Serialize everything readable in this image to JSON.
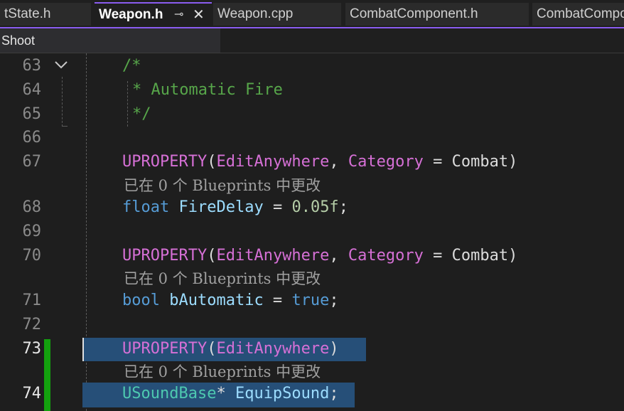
{
  "tabs": [
    {
      "label": "tState.h"
    },
    {
      "label": "Weapon.h",
      "pin": "⊸",
      "close": "✕"
    },
    {
      "label": "Weapon.cpp"
    },
    {
      "label": "CombatComponent.h"
    },
    {
      "label": "CombatCompo"
    }
  ],
  "scope": "Shoot",
  "code": {
    "l63": {
      "num": "63",
      "text": "/*"
    },
    "l64": {
      "num": "64",
      "text": "* Automatic Fire"
    },
    "l65": {
      "num": "65",
      "text": "*/"
    },
    "l66": {
      "num": "66"
    },
    "l67": {
      "num": "67",
      "macro": "UPROPERTY",
      "open": "(",
      "spec": "EditAnywhere",
      "comma": ", ",
      "cat": "Category",
      "eq": " = ",
      "val": "Combat",
      "close": ")"
    },
    "h67": "已在 0 个 Blueprints 中更改",
    "l68": {
      "num": "68",
      "type": "float",
      "name": "FireDelay",
      "eq": " = ",
      "value": "0.05f",
      "semi": ";"
    },
    "l69": {
      "num": "69"
    },
    "l70": {
      "num": "70",
      "macro": "UPROPERTY",
      "open": "(",
      "spec": "EditAnywhere",
      "comma": ", ",
      "cat": "Category",
      "eq": " = ",
      "val": "Combat",
      "close": ")"
    },
    "h70": "已在 0 个 Blueprints 中更改",
    "l71": {
      "num": "71",
      "type": "bool",
      "name": "bAutomatic",
      "eq": " = ",
      "value": "true",
      "semi": ";"
    },
    "l72": {
      "num": "72"
    },
    "l73": {
      "num": "73",
      "macro": "UPROPERTY",
      "open": "(",
      "spec": "EditAnywhere",
      "close": ")"
    },
    "h73": "已在 0 个 Blueprints 中更改",
    "l74": {
      "num": "74",
      "type": "USoundBase",
      "star": "*",
      "name": "EquipSound",
      "semi": ";"
    }
  },
  "icons": {
    "fold": "chevron-down-icon"
  },
  "colors": {
    "accent": "#8a5cf0",
    "changed": "#13a10e",
    "selection": "#264f78"
  }
}
